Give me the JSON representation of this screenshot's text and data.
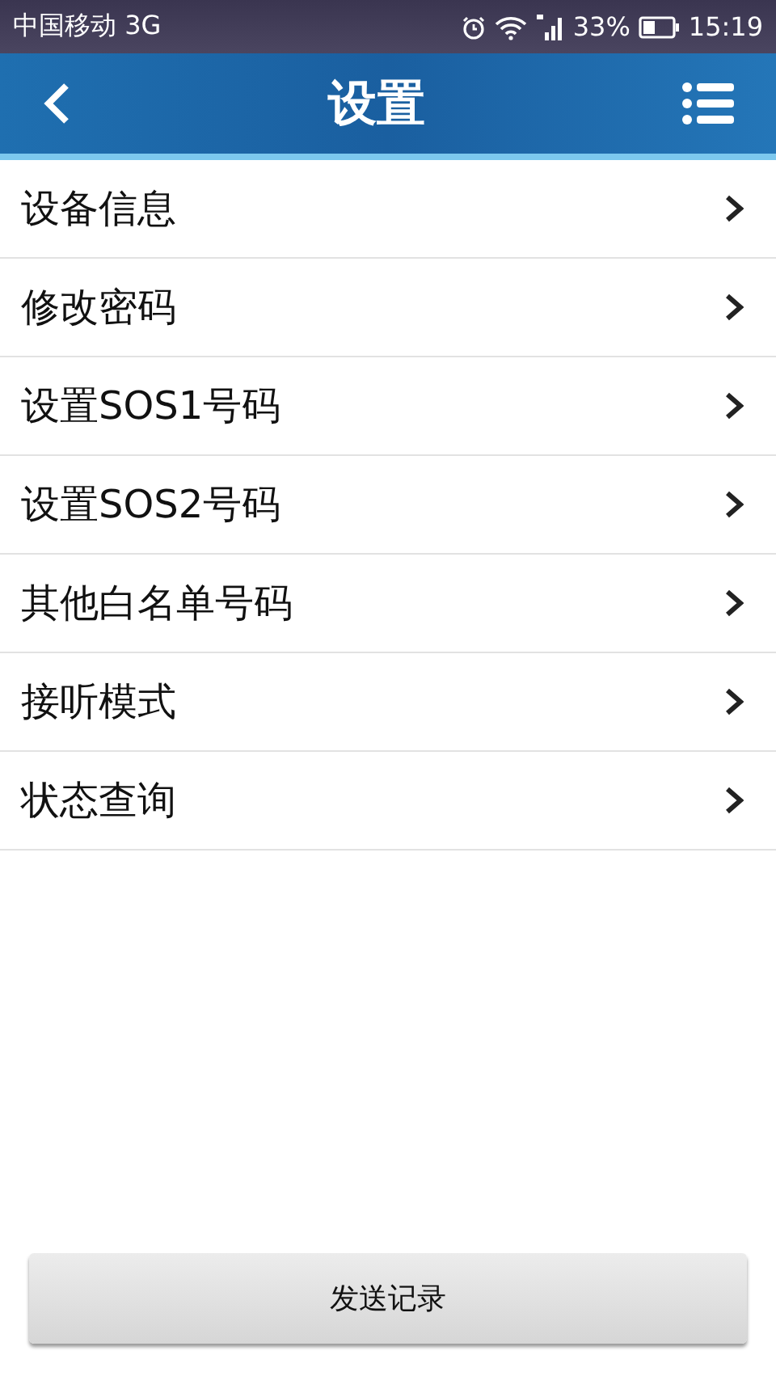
{
  "status_bar": {
    "carrier": "中国移动 3G",
    "battery": "33%",
    "time": "15:19"
  },
  "header": {
    "title": "设置"
  },
  "items": [
    {
      "label": "设备信息"
    },
    {
      "label": "修改密码"
    },
    {
      "label": "设置SOS1号码"
    },
    {
      "label": "设置SOS2号码"
    },
    {
      "label": "其他白名单号码"
    },
    {
      "label": "接听模式"
    },
    {
      "label": "状态查询"
    }
  ],
  "footer_button": "发送记录"
}
